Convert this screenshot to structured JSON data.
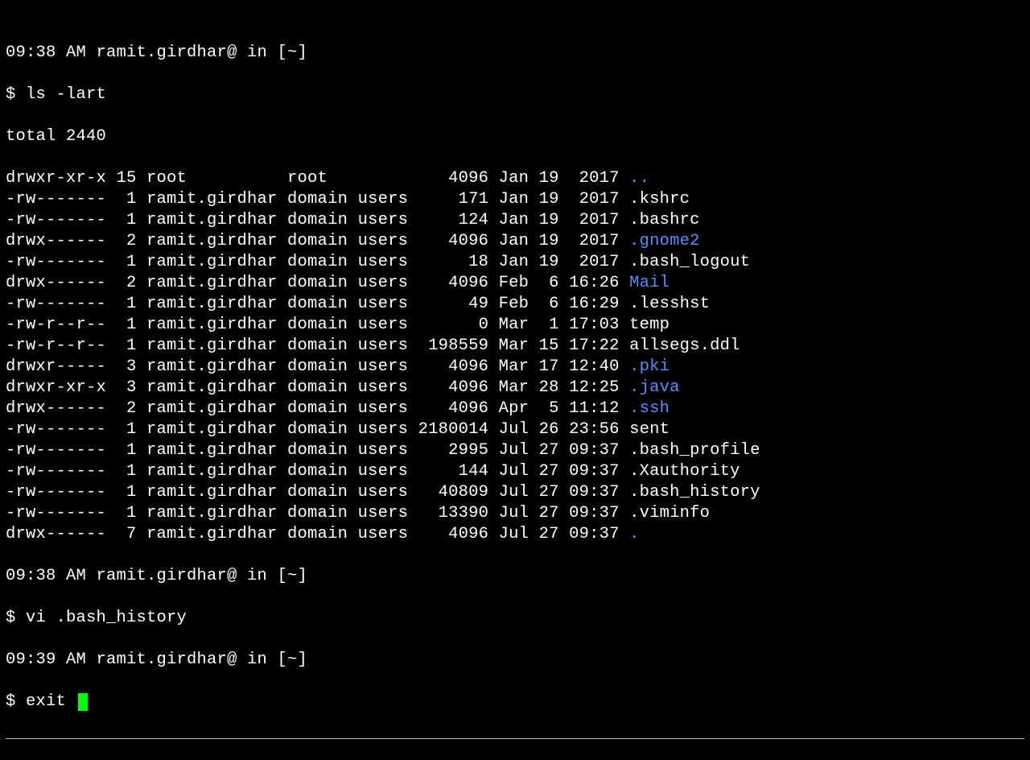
{
  "prompt1": "09:38 AM ramit.girdhar@ in [~]",
  "cmd1": "$ ls -lart",
  "total": "total 2440",
  "rows": [
    {
      "perm": "drwxr-xr-x",
      "links": "15",
      "owner": "root         ",
      "group": "root        ",
      "size": "   4096",
      "date": "Jan 19  2017",
      "name": "..",
      "dir": true
    },
    {
      "perm": "-rw-------",
      "links": " 1",
      "owner": "ramit.girdhar",
      "group": "domain users",
      "size": "    171",
      "date": "Jan 19  2017",
      "name": ".kshrc",
      "dir": false
    },
    {
      "perm": "-rw-------",
      "links": " 1",
      "owner": "ramit.girdhar",
      "group": "domain users",
      "size": "    124",
      "date": "Jan 19  2017",
      "name": ".bashrc",
      "dir": false
    },
    {
      "perm": "drwx------",
      "links": " 2",
      "owner": "ramit.girdhar",
      "group": "domain users",
      "size": "   4096",
      "date": "Jan 19  2017",
      "name": ".gnome2",
      "dir": true
    },
    {
      "perm": "-rw-------",
      "links": " 1",
      "owner": "ramit.girdhar",
      "group": "domain users",
      "size": "     18",
      "date": "Jan 19  2017",
      "name": ".bash_logout",
      "dir": false
    },
    {
      "perm": "drwx------",
      "links": " 2",
      "owner": "ramit.girdhar",
      "group": "domain users",
      "size": "   4096",
      "date": "Feb  6 16:26",
      "name": "Mail",
      "dir": true
    },
    {
      "perm": "-rw-------",
      "links": " 1",
      "owner": "ramit.girdhar",
      "group": "domain users",
      "size": "     49",
      "date": "Feb  6 16:29",
      "name": ".lesshst",
      "dir": false
    },
    {
      "perm": "-rw-r--r--",
      "links": " 1",
      "owner": "ramit.girdhar",
      "group": "domain users",
      "size": "      0",
      "date": "Mar  1 17:03",
      "name": "temp",
      "dir": false
    },
    {
      "perm": "-rw-r--r--",
      "links": " 1",
      "owner": "ramit.girdhar",
      "group": "domain users",
      "size": " 198559",
      "date": "Mar 15 17:22",
      "name": "allsegs.ddl",
      "dir": false
    },
    {
      "perm": "drwxr-----",
      "links": " 3",
      "owner": "ramit.girdhar",
      "group": "domain users",
      "size": "   4096",
      "date": "Mar 17 12:40",
      "name": ".pki",
      "dir": true
    },
    {
      "perm": "drwxr-xr-x",
      "links": " 3",
      "owner": "ramit.girdhar",
      "group": "domain users",
      "size": "   4096",
      "date": "Mar 28 12:25",
      "name": ".java",
      "dir": true
    },
    {
      "perm": "drwx------",
      "links": " 2",
      "owner": "ramit.girdhar",
      "group": "domain users",
      "size": "   4096",
      "date": "Apr  5 11:12",
      "name": ".ssh",
      "dir": true
    },
    {
      "perm": "-rw-------",
      "links": " 1",
      "owner": "ramit.girdhar",
      "group": "domain users",
      "size": "2180014",
      "date": "Jul 26 23:56",
      "name": "sent",
      "dir": false
    },
    {
      "perm": "-rw-------",
      "links": " 1",
      "owner": "ramit.girdhar",
      "group": "domain users",
      "size": "   2995",
      "date": "Jul 27 09:37",
      "name": ".bash_profile",
      "dir": false
    },
    {
      "perm": "-rw-------",
      "links": " 1",
      "owner": "ramit.girdhar",
      "group": "domain users",
      "size": "    144",
      "date": "Jul 27 09:37",
      "name": ".Xauthority",
      "dir": false
    },
    {
      "perm": "-rw-------",
      "links": " 1",
      "owner": "ramit.girdhar",
      "group": "domain users",
      "size": "  40809",
      "date": "Jul 27 09:37",
      "name": ".bash_history",
      "dir": false
    },
    {
      "perm": "-rw-------",
      "links": " 1",
      "owner": "ramit.girdhar",
      "group": "domain users",
      "size": "  13390",
      "date": "Jul 27 09:37",
      "name": ".viminfo",
      "dir": false
    },
    {
      "perm": "drwx------",
      "links": " 7",
      "owner": "ramit.girdhar",
      "group": "domain users",
      "size": "   4096",
      "date": "Jul 27 09:37",
      "name": ".",
      "dir": true
    }
  ],
  "prompt2": "09:38 AM ramit.girdhar@ in [~]",
  "cmd2": "$ vi .bash_history",
  "prompt3": "09:39 AM ramit.girdhar@ in [~]",
  "cmd3": "$ exit "
}
